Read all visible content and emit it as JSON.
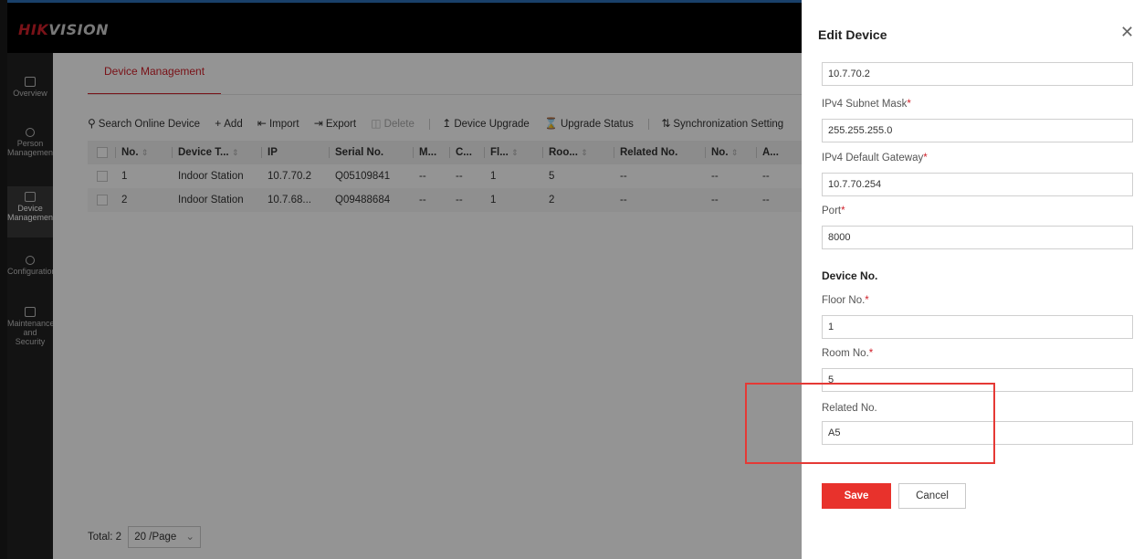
{
  "app": {
    "logo_brand": "HIK",
    "logo_rest": "VISION"
  },
  "nav": [
    {
      "label": "Overview",
      "icon": "overview-icon"
    },
    {
      "label": "Person Management",
      "icon": "person-icon"
    },
    {
      "label": "Device Management",
      "icon": "device-icon",
      "active": true
    },
    {
      "label": "Configuration",
      "icon": "gear-icon"
    },
    {
      "label": "Maintenance and Security",
      "icon": "maintenance-icon"
    }
  ],
  "main": {
    "tab": "Device Management",
    "toolbar": {
      "search": "Search Online Device",
      "add": "Add",
      "import": "Import",
      "export": "Export",
      "delete": "Delete",
      "upgrade": "Device Upgrade",
      "upgrade_status": "Upgrade Status",
      "sync": "Synchronization Setting"
    },
    "columns": [
      "No.",
      "Device T...",
      "IP",
      "Serial No.",
      "M...",
      "C...",
      "Fl...",
      "Roo...",
      "Related No.",
      "No.",
      "A..."
    ],
    "rows": [
      [
        "1",
        "Indoor Station",
        "10.7.70.2",
        "Q05109841",
        "--",
        "--",
        "1",
        "5",
        "--",
        "--",
        "--"
      ],
      [
        "2",
        "Indoor Station",
        "10.7.68...",
        "Q09488684",
        "--",
        "--",
        "1",
        "2",
        "--",
        "--",
        "--"
      ]
    ],
    "pager": {
      "total": "Total: 2",
      "page_size": "20 /Page"
    }
  },
  "drawer": {
    "title": "Edit Device",
    "ip_value": "10.7.70.2",
    "subnet_label": "IPv4 Subnet Mask",
    "subnet_value": "255.255.255.0",
    "gateway_label": "IPv4 Default Gateway",
    "gateway_value": "10.7.70.254",
    "port_label": "Port",
    "port_value": "8000",
    "section_device_no": "Device No.",
    "floor_label": "Floor No.",
    "floor_value": "1",
    "room_label": "Room No.",
    "room_value": "5",
    "related_label": "Related No.",
    "related_value": "A5",
    "required_mark": "*",
    "save": "Save",
    "cancel": "Cancel"
  },
  "colors": {
    "accent": "#d0202a",
    "save_button": "#e8322c",
    "highlight": "#e53935"
  }
}
